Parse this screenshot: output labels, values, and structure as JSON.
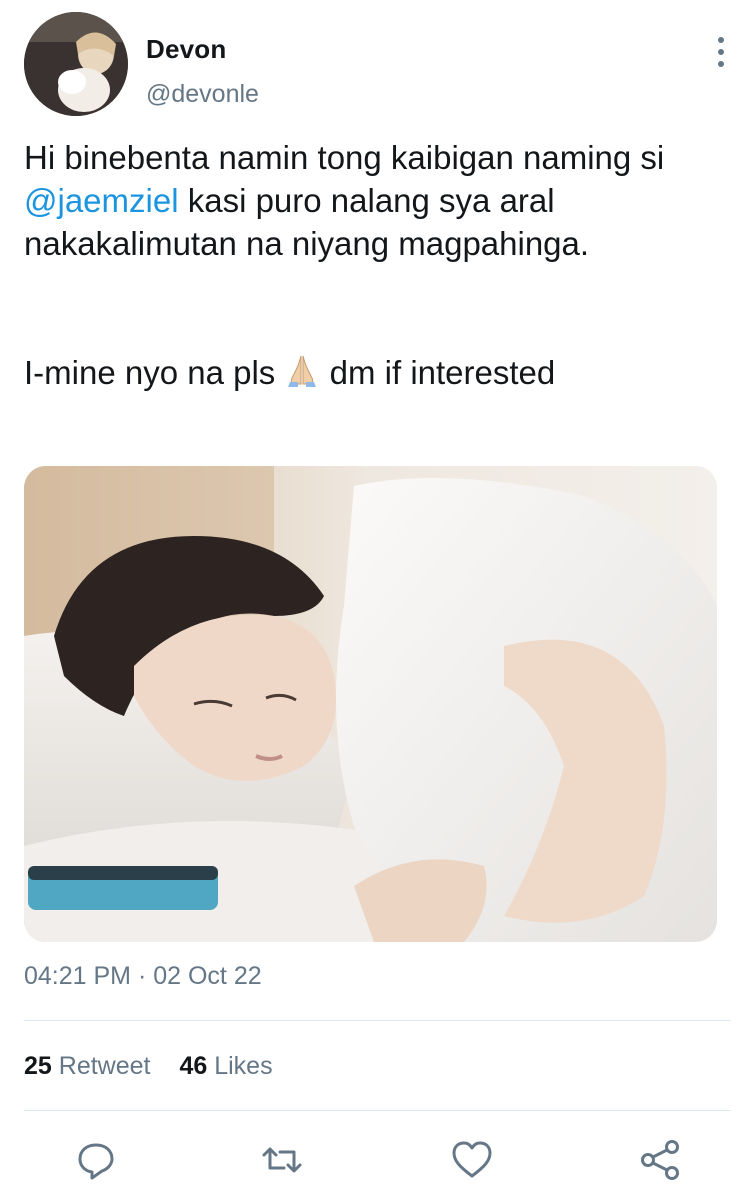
{
  "tweet": {
    "author_name": "Devon",
    "author_handle": "@devonle",
    "text_part1": "Hi binebenta namin tong kaibigan naming si ",
    "mention": "@jaemziel",
    "text_part2": " kasi puro nalang sya aral nakakalimutan na niyang magpahinga.",
    "text_line2_a": "I-mine nyo na pls ",
    "text_line2_emoji": "folded-hands-emoji",
    "text_line2_b": " dm if interested",
    "timestamp": "04:21 PM · 02 Oct 22",
    "retweet_count": "25",
    "retweet_label": "Retweet",
    "like_count": "46",
    "like_label": "Likes"
  },
  "icons": {
    "more": "more-vertical-icon",
    "reply": "reply-icon",
    "retweet": "retweet-icon",
    "like": "heart-icon",
    "share": "share-icon"
  },
  "colors": {
    "text": "#14171a",
    "secondary": "#657786",
    "link": "#1b95e0",
    "divider": "#e1e8ed"
  }
}
